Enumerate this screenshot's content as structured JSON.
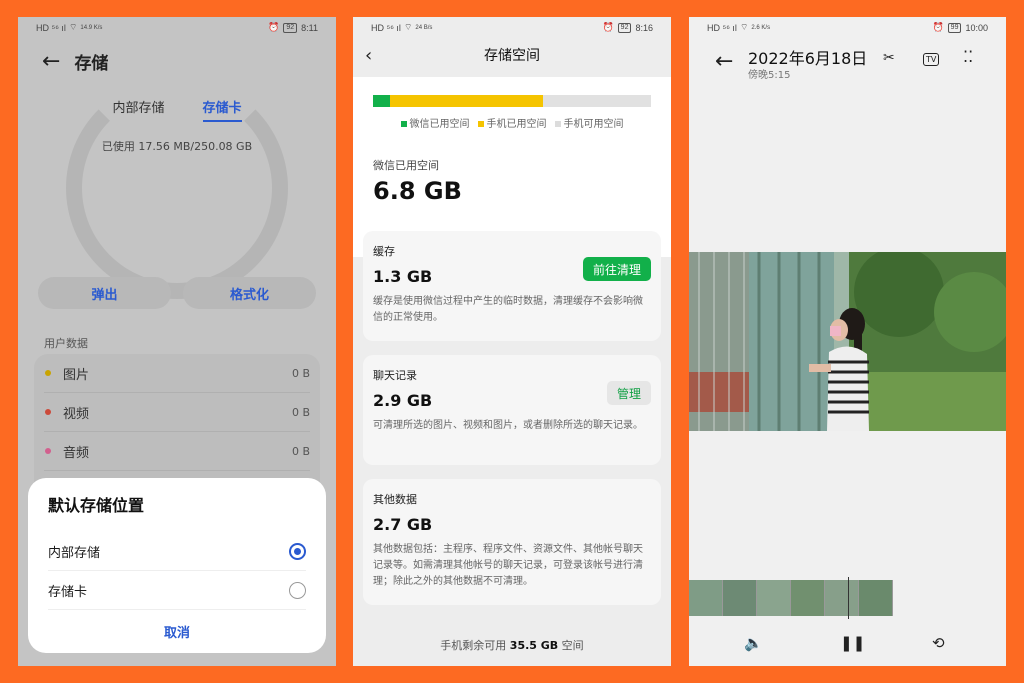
{
  "phone1": {
    "status": {
      "left": "HD ⁵⁶ ıl",
      "speed": "14.9\nK/s",
      "battery": "92",
      "time": "8:11"
    },
    "title": "存储",
    "tabs": [
      "内部存储",
      "存储卡"
    ],
    "used_text": "已使用 17.56 MB/250.08 GB",
    "buttons": [
      "弹出",
      "格式化"
    ],
    "section_label": "用户数据",
    "items": [
      {
        "name": "图片",
        "size": "0 B",
        "color": "#c9a400"
      },
      {
        "name": "视频",
        "size": "0 B",
        "color": "#cc4a3a"
      },
      {
        "name": "音频",
        "size": "0 B",
        "color": "#d2608e"
      }
    ],
    "dialog": {
      "title": "默认存储位置",
      "options": [
        {
          "label": "内部存储",
          "selected": true
        },
        {
          "label": "存储卡",
          "selected": false
        }
      ],
      "cancel": "取消"
    }
  },
  "phone2": {
    "status": {
      "left": "HD ⁵⁶ ıl",
      "speed": "24\nB/s",
      "battery": "92",
      "time": "8:16"
    },
    "title": "存储空间",
    "bar": {
      "wechat": 0.06,
      "phone": 0.61
    },
    "legend": [
      {
        "label": "微信已用空间",
        "color": "#12b04a"
      },
      {
        "label": "手机已用空间",
        "color": "#f5c400"
      },
      {
        "label": "手机可用空间",
        "color": "#dcdcdc"
      }
    ],
    "wechat_label": "微信已用空间",
    "wechat_size": "6.8 GB",
    "cards": [
      {
        "label": "缓存",
        "size": "1.3 GB",
        "button": "前往清理",
        "desc": "缓存是使用微信过程中产生的临时数据，清理缓存不会影响微信的正常使用。"
      },
      {
        "label": "聊天记录",
        "size": "2.9 GB",
        "button": "管理",
        "desc": "可清理所选的图片、视频和图片，或者删除所选的聊天记录。"
      },
      {
        "label": "其他数据",
        "size": "2.7 GB",
        "button": "",
        "desc": "其他数据包括：主程序、程序文件、资源文件、其他帐号聊天记录等。如需清理其他帐号的聊天记录，可登录该帐号进行清理；除此之外的其他数据不可清理。"
      }
    ],
    "free_prefix": "手机剩余可用 ",
    "free_value": "35.5 GB",
    "free_suffix": " 空间"
  },
  "phone3": {
    "status": {
      "left": "HD ⁵⁶ ıl",
      "speed": "2.6\nK/s",
      "battery": "99",
      "time": "10:00"
    },
    "date": "2022年6月18日",
    "time": "傍晚5:15",
    "icons": [
      "scissors-icon",
      "tv-icon",
      "more-icon"
    ],
    "controls": [
      "volume-icon",
      "pause-icon",
      "rotate-icon"
    ]
  }
}
